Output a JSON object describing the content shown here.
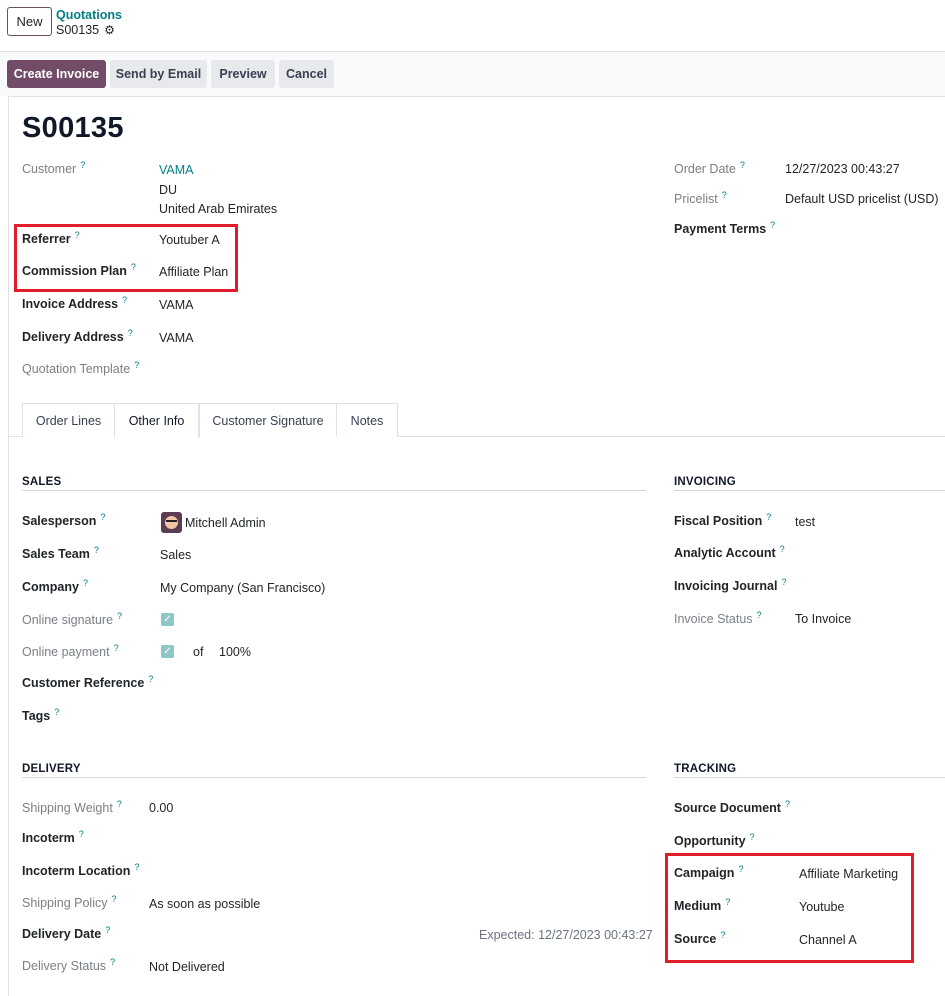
{
  "header": {
    "new_label": "New",
    "breadcrumb_parent": "Quotations",
    "breadcrumb_current": "S00135"
  },
  "actions": {
    "create_invoice": "Create Invoice",
    "send_email": "Send by Email",
    "preview": "Preview",
    "cancel": "Cancel"
  },
  "record": {
    "title": "S00135",
    "customer_label": "Customer",
    "customer_name": "VAMA",
    "customer_line2": "DU",
    "customer_line3": "United Arab Emirates",
    "referrer_label": "Referrer",
    "referrer_value": "Youtuber A",
    "commission_label": "Commission Plan",
    "commission_value": "Affiliate Plan",
    "invoice_address_label": "Invoice Address",
    "invoice_address_value": "VAMA",
    "delivery_address_label": "Delivery Address",
    "delivery_address_value": "VAMA",
    "quotation_template_label": "Quotation Template",
    "order_date_label": "Order Date",
    "order_date_value": "12/27/2023 00:43:27",
    "pricelist_label": "Pricelist",
    "pricelist_value": "Default USD pricelist (USD)",
    "payment_terms_label": "Payment Terms"
  },
  "tabs": [
    "Order Lines",
    "Other Info",
    "Customer Signature",
    "Notes"
  ],
  "sales": {
    "heading": "SALES",
    "salesperson_label": "Salesperson",
    "salesperson_value": "Mitchell Admin",
    "team_label": "Sales Team",
    "team_value": "Sales",
    "company_label": "Company",
    "company_value": "My Company (San Francisco)",
    "online_signature_label": "Online signature",
    "online_payment_label": "Online payment",
    "online_payment_of": "of",
    "online_payment_pct": "100%",
    "customer_reference_label": "Customer Reference",
    "tags_label": "Tags"
  },
  "invoicing": {
    "heading": "INVOICING",
    "fiscal_label": "Fiscal Position",
    "fiscal_value": "test",
    "analytic_label": "Analytic Account",
    "journal_label": "Invoicing Journal",
    "status_label": "Invoice Status",
    "status_value": "To Invoice"
  },
  "delivery": {
    "heading": "DELIVERY",
    "weight_label": "Shipping Weight",
    "weight_value": "0.00",
    "incoterm_label": "Incoterm",
    "incoterm_location_label": "Incoterm Location",
    "policy_label": "Shipping Policy",
    "policy_value": "As soon as possible",
    "date_label": "Delivery Date",
    "expected": "Expected: 12/27/2023 00:43:27",
    "status_label": "Delivery Status",
    "status_value": "Not Delivered"
  },
  "tracking": {
    "heading": "TRACKING",
    "source_doc_label": "Source Document",
    "opportunity_label": "Opportunity",
    "campaign_label": "Campaign",
    "campaign_value": "Affiliate Marketing",
    "medium_label": "Medium",
    "medium_value": "Youtube",
    "source_label": "Source",
    "source_value": "Channel A"
  },
  "help_marker": "?",
  "colors": {
    "brand": "#714b67",
    "link": "#017e84",
    "highlight": "#e11d2a"
  }
}
